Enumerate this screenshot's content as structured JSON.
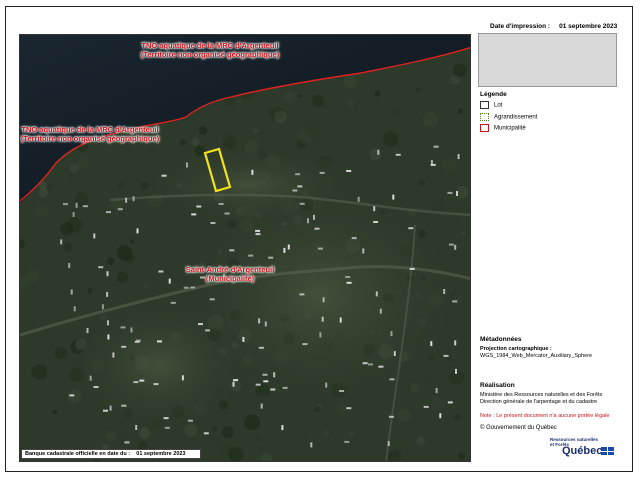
{
  "header": {
    "print_date_label": "Date d'impression :",
    "print_date_value": "01 septembre 2023"
  },
  "map": {
    "labels": {
      "tno_north": "TNO aquatique de la MRC d'Argenteuil",
      "tno_north_sub": "(Territoire non organisé géographique)",
      "tno_west": "TNO aquatique de la MRC d'Argenteuil",
      "tno_west_sub": "(Territoire non organisé géographique)",
      "municipality": "Saint-André-d'Argenteuil",
      "municipality_sub": "(Municipalité)"
    },
    "banque": {
      "label": "Banque cadastrale officielle en date du :",
      "date": "01 septembre 2023"
    },
    "colors": {
      "water": "#101a22",
      "forest": "#2e3a29",
      "municipal_boundary": "#e0211f",
      "selected_lot": "#f3e21c",
      "building": "#e8e8e8"
    }
  },
  "legend": {
    "title": "Légende",
    "items": [
      {
        "label": "Lot",
        "icon": "lot-swatch"
      },
      {
        "label": "Agrandissement",
        "icon": "enlargement-swatch"
      },
      {
        "label": "Municipalité",
        "icon": "municipality-swatch"
      }
    ]
  },
  "metadata": {
    "title": "Métadonnées",
    "projection_label": "Projection cartographique :",
    "projection_value": "WGS_1984_Web_Mercator_Auxiliary_Sphere"
  },
  "realisation": {
    "title": "Réalisation",
    "line1": "Ministère des Ressources naturelles et des Forêts",
    "line2": "Direction générale de l'arpentage et du cadastre",
    "note": "Note : Le présent document n'a aucune portée légale",
    "copyright": "© Gouvernement du Québec"
  },
  "logo": {
    "ministry_line1": "Ressources naturelles",
    "ministry_line2": "et Forêts",
    "wordmark": "Québec"
  }
}
